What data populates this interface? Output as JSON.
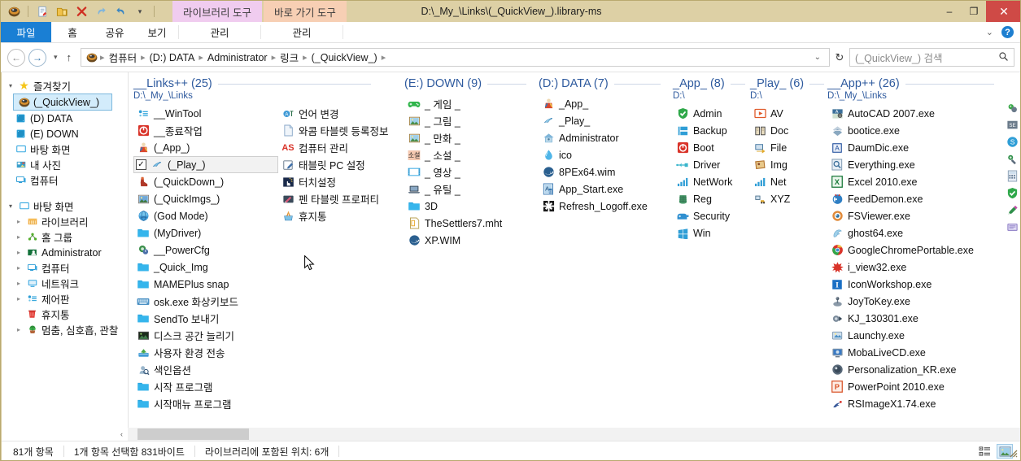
{
  "window": {
    "title": "D:\\_My_\\Links\\(_QuickView_).library-ms",
    "minimize": "–",
    "maximize": "❐",
    "close": "✕"
  },
  "quick_access_toolbar": {
    "icons": [
      "explorer-library-icon",
      "properties-icon",
      "new-folder-icon",
      "delete-icon",
      "redo-icon",
      "undo-icon",
      "qat-dropdown-icon"
    ]
  },
  "contextual_tabs": [
    {
      "label": "라이브러리 도구",
      "kind": "library"
    },
    {
      "label": "바로 가기 도구",
      "kind": "shortcut"
    }
  ],
  "ribbon_tabs": [
    {
      "label": "파일",
      "active": true
    },
    {
      "label": "홈",
      "active": false
    },
    {
      "label": "공유",
      "active": false
    },
    {
      "label": "보기",
      "active": false
    },
    {
      "label": "관리",
      "active": false
    },
    {
      "label": "관리",
      "active": false
    }
  ],
  "ribbon_right": {
    "collapse": "⌄",
    "help": "?"
  },
  "address_bar": {
    "back": "←",
    "forward": "→",
    "history": "▾",
    "up": "↑",
    "crumbs": [
      "컴퓨터",
      "(D:) DATA",
      "Administrator",
      "링크",
      "(_QuickView_)"
    ],
    "separator": "▸",
    "dropdown": "⌄",
    "refresh": "↻"
  },
  "search": {
    "placeholder": "(_QuickView_) 검색",
    "value": "",
    "icon": "search-icon"
  },
  "sidebar": {
    "sections": [
      {
        "label": "즐겨찾기",
        "icon": "star-icon",
        "expanded": true,
        "items": [
          {
            "label": "(_QuickView_)",
            "icon": "library-icon",
            "selected": true
          },
          {
            "label": "(D) DATA",
            "icon": "drive-icon",
            "selected": false
          },
          {
            "label": "(E) DOWN",
            "icon": "drive-icon",
            "selected": false
          },
          {
            "label": "바탕 화면",
            "icon": "desktop-icon",
            "selected": false
          },
          {
            "label": "내 사진",
            "icon": "pictures-icon",
            "selected": false
          },
          {
            "label": "컴퓨터",
            "icon": "computer-icon",
            "selected": false
          }
        ]
      },
      {
        "label": "바탕 화면",
        "icon": "desktop-icon",
        "expanded": true,
        "items": [
          {
            "label": "라이브러리",
            "icon": "libraries-icon",
            "expandable": true
          },
          {
            "label": "홈 그룹",
            "icon": "homegroup-icon",
            "expandable": true
          },
          {
            "label": "Administrator",
            "icon": "user-folder-icon",
            "expandable": true
          },
          {
            "label": "컴퓨터",
            "icon": "computer-icon",
            "expandable": true
          },
          {
            "label": "네트워크",
            "icon": "network-icon",
            "expandable": true
          },
          {
            "label": "제어판",
            "icon": "control-panel-icon",
            "expandable": true
          },
          {
            "label": "휴지통",
            "icon": "recycle-bin-icon",
            "expandable": false
          },
          {
            "label": "멈춤, 심호흡, 관찰",
            "icon": "plant-icon",
            "expandable": true
          }
        ]
      }
    ]
  },
  "groups": [
    {
      "title": "__Links++ (25)",
      "path": "D:\\_My_\\Links",
      "columns": [
        [
          {
            "name": "__WinTool",
            "icon": "control-panel-icon"
          },
          {
            "name": "__종료작업",
            "icon": "shutdown-icon"
          },
          {
            "name": "(_App_)",
            "icon": "app-folder-icon"
          },
          {
            "name": "(_Play_)",
            "icon": "play-wing-icon",
            "selected": true,
            "checked": true
          },
          {
            "name": "(_QuickDown_)",
            "icon": "boot-icon"
          },
          {
            "name": "(_QuickImgs_)",
            "icon": "image-folder-icon"
          },
          {
            "name": "(God Mode)",
            "icon": "god-mode-icon"
          },
          {
            "name": "(MyDriver)",
            "icon": "folder-icon"
          },
          {
            "name": "__PowerCfg",
            "icon": "power-cfg-icon"
          },
          {
            "name": "_Quick_Img",
            "icon": "folder-icon"
          },
          {
            "name": "MAMEPlus snap",
            "icon": "folder-icon"
          },
          {
            "name": "osk.exe 화상키보드",
            "icon": "keyboard-icon"
          },
          {
            "name": "SendTo 보내기",
            "icon": "folder-icon"
          },
          {
            "name": "디스크 공간 늘리기",
            "icon": "disk-cleanup-icon"
          },
          {
            "name": "사용자 환경 전송",
            "icon": "transfer-icon"
          },
          {
            "name": "색인옵션",
            "icon": "index-options-icon"
          },
          {
            "name": "시작 프로그램",
            "icon": "folder-icon"
          },
          {
            "name": "시작매뉴 프로그램",
            "icon": "folder-icon"
          }
        ],
        [
          {
            "name": "언어 변경",
            "icon": "language-icon"
          },
          {
            "name": "와콤 타블렛 등록정보",
            "icon": "document-icon"
          },
          {
            "name": "컴퓨터 관리",
            "icon": "as-icon"
          },
          {
            "name": "태블릿 PC 설정",
            "icon": "tablet-pc-icon"
          },
          {
            "name": "터치설정",
            "icon": "touch-icon"
          },
          {
            "name": "펜 타블렛 프로퍼티",
            "icon": "pen-tablet-icon"
          },
          {
            "name": "휴지통",
            "icon": "recycle-bin-icon"
          }
        ]
      ]
    },
    {
      "title": "(E:) DOWN (9)",
      "path": "",
      "columns": [
        [
          {
            "name": "_ 게임 _",
            "icon": "gamepad-icon"
          },
          {
            "name": "_ 그림 _",
            "icon": "picture-icon"
          },
          {
            "name": "_ 만화 _",
            "icon": "picture-icon"
          },
          {
            "name": "_ 소설 _",
            "icon": "novel-icon"
          },
          {
            "name": "_ 영상 _",
            "icon": "film-icon"
          },
          {
            "name": "_ 유틸 _",
            "icon": "laptop-icon"
          },
          {
            "name": "3D",
            "icon": "folder-icon"
          },
          {
            "name": "TheSettlers7.mht",
            "icon": "mht-icon"
          },
          {
            "name": "XP.WIM",
            "icon": "wim-icon"
          }
        ]
      ]
    },
    {
      "title": "(D:) DATA (7)",
      "path": "",
      "columns": [
        [
          {
            "name": "_App_",
            "icon": "app-folder-icon"
          },
          {
            "name": "_Play_",
            "icon": "play-wing-icon"
          },
          {
            "name": "Administrator",
            "icon": "user-folder-icon"
          },
          {
            "name": "ico",
            "icon": "droplet-icon"
          },
          {
            "name": "8PEx64.wim",
            "icon": "wim-icon"
          },
          {
            "name": "App_Start.exe",
            "icon": "app-start-icon"
          },
          {
            "name": "Refresh_Logoff.exe",
            "icon": "refresh-logoff-icon"
          }
        ]
      ]
    },
    {
      "title": "_App_ (8)",
      "path": "D:\\",
      "columns": [
        [
          {
            "name": "Admin",
            "icon": "shield-icon"
          },
          {
            "name": "Backup",
            "icon": "backup-icon"
          },
          {
            "name": "Boot",
            "icon": "power-icon"
          },
          {
            "name": "Driver",
            "icon": "usb-icon"
          },
          {
            "name": "NetWork",
            "icon": "signal-icon"
          },
          {
            "name": "Reg",
            "icon": "registry-icon"
          },
          {
            "name": "Security",
            "icon": "security-icon"
          },
          {
            "name": "Win",
            "icon": "windows-icon"
          }
        ]
      ]
    },
    {
      "title": "_Play_ (6)",
      "path": "D:\\",
      "columns": [
        [
          {
            "name": "AV",
            "icon": "av-play-icon"
          },
          {
            "name": "Doc",
            "icon": "book-icon"
          },
          {
            "name": "File",
            "icon": "file-transfer-icon"
          },
          {
            "name": "Img",
            "icon": "img-icon"
          },
          {
            "name": "Net",
            "icon": "signal-icon"
          },
          {
            "name": "XYZ",
            "icon": "xyz-icon"
          }
        ]
      ]
    },
    {
      "title": "__App++ (26)",
      "path": "D:\\_My_\\Links",
      "columns": [
        [
          {
            "name": "AutoCAD 2007.exe",
            "icon": "autocad-icon"
          },
          {
            "name": "bootice.exe",
            "icon": "bootice-icon"
          },
          {
            "name": "DaumDic.exe",
            "icon": "daumdic-icon"
          },
          {
            "name": "Everything.exe",
            "icon": "everything-icon"
          },
          {
            "name": "Excel 2010.exe",
            "icon": "excel-icon"
          },
          {
            "name": "FeedDemon.exe",
            "icon": "feeddemon-icon"
          },
          {
            "name": "FSViewer.exe",
            "icon": "fsviewer-icon"
          },
          {
            "name": "ghost64.exe",
            "icon": "ghost-icon"
          },
          {
            "name": "GoogleChromePortable.exe",
            "icon": "chrome-icon"
          },
          {
            "name": "i_view32.exe",
            "icon": "irfanview-icon"
          },
          {
            "name": "IconWorkshop.exe",
            "icon": "iconworkshop-icon"
          },
          {
            "name": "JoyToKey.exe",
            "icon": "joytokey-icon"
          },
          {
            "name": "KJ_130301.exe",
            "icon": "kj-icon"
          },
          {
            "name": "Launchy.exe",
            "icon": "launchy-icon"
          },
          {
            "name": "MobaLiveCD.exe",
            "icon": "mobalivecd-icon"
          },
          {
            "name": "Personalization_KR.exe",
            "icon": "personalization-icon"
          },
          {
            "name": "PowerPoint 2010.exe",
            "icon": "powerpoint-icon"
          },
          {
            "name": "RSImageX1.74.exe",
            "icon": "rsimagex-icon"
          }
        ]
      ]
    },
    {
      "title": "",
      "path": "",
      "clipped": true,
      "columns": [
        [
          {
            "name": "",
            "icon": "sandboxie-icon"
          },
          {
            "name": "",
            "icon": "se-icon"
          },
          {
            "name": "",
            "icon": "skype-icon"
          },
          {
            "name": "",
            "icon": "tool-icon"
          },
          {
            "name": "",
            "icon": "calc-icon"
          },
          {
            "name": "",
            "icon": "check-shield-icon"
          },
          {
            "name": "",
            "icon": "paint-icon"
          },
          {
            "name": "",
            "icon": "monitor-icon"
          }
        ]
      ]
    }
  ],
  "hscroll": {
    "left_arrow": "‹"
  },
  "status": {
    "item_count": "81개 항목",
    "selection": "1개 항목 선택함 831바이트",
    "library_info": "라이브러리에 포함된 위치: 6개",
    "views": [
      {
        "name": "details-view",
        "active": false
      },
      {
        "name": "large-icons-view",
        "active": true
      }
    ]
  }
}
